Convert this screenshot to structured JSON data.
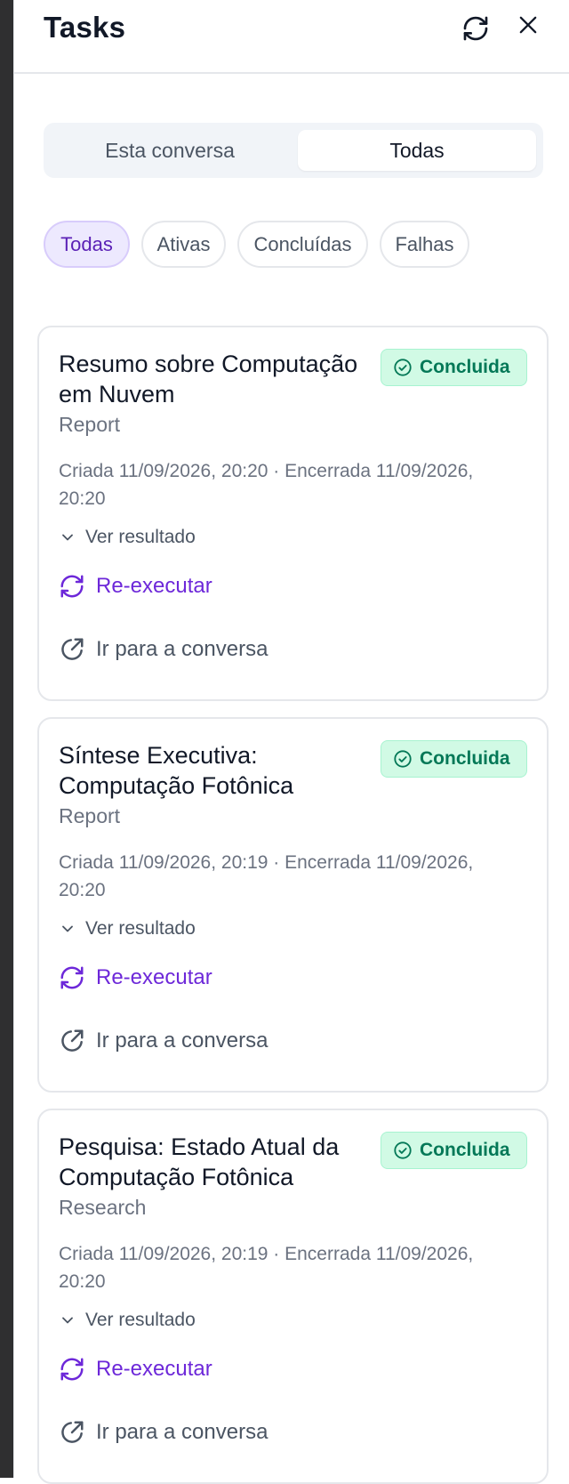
{
  "header": {
    "title": "Tasks",
    "refresh_icon": "refresh-icon",
    "close_icon": "close-icon"
  },
  "scope_tabs": [
    {
      "label": "Esta conversa",
      "selected": false
    },
    {
      "label": "Todas",
      "selected": true
    }
  ],
  "filters": [
    {
      "label": "Todas",
      "active": true
    },
    {
      "label": "Ativas",
      "active": false
    },
    {
      "label": "Concluídas",
      "active": false
    },
    {
      "label": "Falhas",
      "active": false
    }
  ],
  "tasks": [
    {
      "title": "Resumo sobre Computação em Nuvem",
      "type": "Report",
      "status": "Concluida",
      "meta": "Criada 11/09/2026, 20:20 · Encerrada 11/09/2026, 20:20",
      "toggle": "Ver resultado",
      "rerun": "Re-executar",
      "goto": "Ir para a conversa"
    },
    {
      "title": "Síntese Executiva: Computação Fotônica",
      "type": "Report",
      "status": "Concluida",
      "meta": "Criada 11/09/2026, 20:19 · Encerrada 11/09/2026, 20:20",
      "toggle": "Ver resultado",
      "rerun": "Re-executar",
      "goto": "Ir para a conversa"
    },
    {
      "title": "Pesquisa: Estado Atual da Computação Fotônica",
      "type": "Research",
      "status": "Concluida",
      "meta": "Criada 11/09/2026, 20:19 · Encerrada 11/09/2026, 20:20",
      "toggle": "Ver resultado",
      "rerun": "Re-executar",
      "goto": "Ir para a conversa"
    }
  ],
  "colors": {
    "accent": "#6d28d9",
    "status_success_bg": "#d1fae5",
    "status_success_text": "#047857",
    "active_chip_bg": "#ede9fe"
  }
}
